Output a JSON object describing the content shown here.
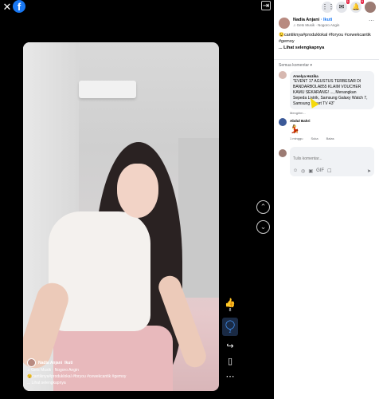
{
  "viewer": {
    "close_icon": "✕",
    "logo_letter": "f",
    "collapse_icon": "⇥",
    "nav_up_icon": "⌃",
    "nav_down_icon": "⌄",
    "caption": {
      "author": "Nadia Anjani",
      "follow": "Ikuti",
      "music": "♫ Gets Musik · Nogoro Angin",
      "text": "😉cantiknya#produklokal #foryou #cewekcantik #gemoy",
      "more": "... Lihat selengkapnya"
    },
    "actions": [
      {
        "icon": "👍",
        "label": "like-button",
        "count": "8"
      },
      {
        "icon": "◯",
        "label": "comment-button",
        "count": "2"
      },
      {
        "icon": "↪",
        "label": "share-button",
        "count": ""
      },
      {
        "icon": "▯",
        "label": "save-button",
        "count": ""
      },
      {
        "icon": "⋯",
        "label": "more-button",
        "count": ""
      }
    ]
  },
  "panel": {
    "topbar": {
      "menu_icon": "⋮⋮",
      "messenger_icon": "✉",
      "messenger_badge": "1",
      "notif_icon": "🔔",
      "notif_badge": "9",
      "profile_icon": "●"
    },
    "post": {
      "author": "Nadia Anjani",
      "follow": "· Ikuti",
      "music": "♫ Gets Musik · Nogoro Angin",
      "more_icon": "⋯",
      "text": "😉cantiknya#produklokal #foryou #cewekcantik #gemoy",
      "see_more": "... Lihat selengkapnya"
    },
    "sort_label": "Semua komentar ▾",
    "comments": [
      {
        "name": "Amelya Hozika",
        "text": "\"EVENT 17 AGUSTUS TERBESAR DI BANDARBOLA855 KLAIM VOUCHER KAMU SEKARANG! ..., Menangkan Sepeda Listrik, Samsung Galaxy Watch 7, Samsung Smart TV 43\"",
        "meta": [
          "Mengirim..."
        ],
        "avatar_color": "#d7b8b0"
      },
      {
        "name": "Abdul Bahri",
        "sticker_icon": "💃",
        "meta": [
          "1 minggu",
          "Suka",
          "Balas"
        ],
        "avatar_color": "#3b5998"
      }
    ],
    "reply": {
      "placeholder": "Tulis komentar...",
      "tools": [
        "☺",
        "◎",
        "▣",
        "GIF",
        "☐"
      ],
      "send_icon": "➤"
    }
  }
}
